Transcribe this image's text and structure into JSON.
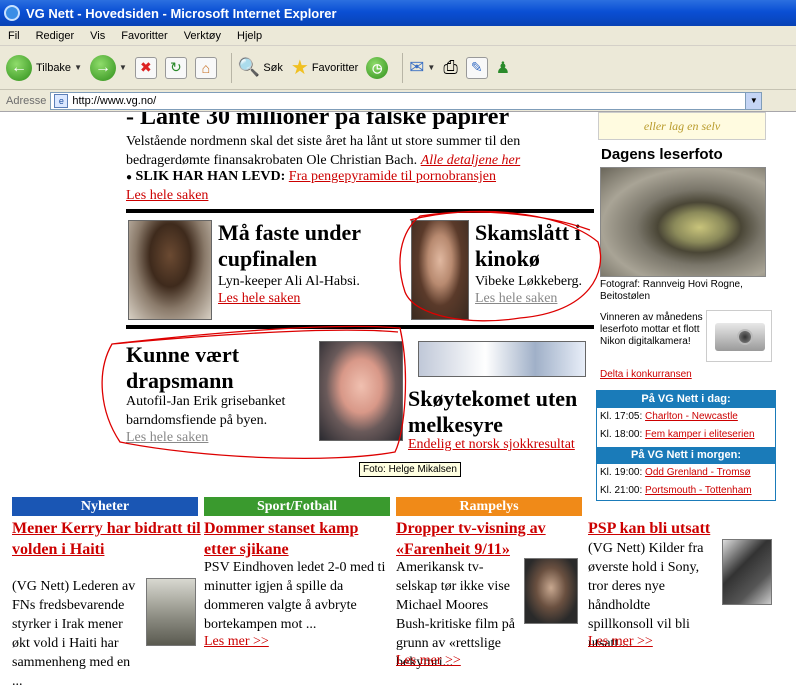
{
  "window": {
    "title": "VG Nett - Hovedsiden - Microsoft Internet Explorer"
  },
  "menu": [
    "Fil",
    "Rediger",
    "Vis",
    "Favoritter",
    "Verktøy",
    "Hjelp"
  ],
  "toolbar": {
    "back": "Tilbake",
    "search": "Søk",
    "favorites": "Favoritter"
  },
  "address": {
    "label": "Adresse",
    "url": "http://www.vg.no/"
  },
  "top_story": {
    "headline": "- Lånte 30 millioner på falske papirer",
    "lead": "Velstående nordmenn skal det siste året ha lånt ut store summer til den bedragerdømte finansakrobaten Ole Christian Bach.",
    "lead_link": "Alle detaljene her",
    "bullet_label": "SLIK HAR HAN LEVD:",
    "bullet_link": "Fra pengepyramide til pornobransjen",
    "more": "Les hele saken"
  },
  "story_cup": {
    "headline": "Må faste under cupfinalen",
    "sub": "Lyn-keeper Ali Al-Habsi.",
    "more": "Les hele saken"
  },
  "story_kino": {
    "headline": "Skamslått i kinokø",
    "sub": "Vibeke Løkkeberg.",
    "more": "Les hele saken"
  },
  "story_drap": {
    "headline": "Kunne vært drapsmann",
    "sub": "Autofil-Jan Erik grisebanket barndomsfiende på byen.",
    "more": "Les hele saken"
  },
  "story_skoyte": {
    "headline": "Skøytekomet uten melkesyre",
    "more": "Endelig et norsk sjokkresultat"
  },
  "photo_credit": "Foto: Helge Mikalsen",
  "sidebar": {
    "banner": "eller lag en selv",
    "leserfoto_title": "Dagens leserfoto",
    "leserfoto_caption": "Fotograf: Rannveig Hovi Rogne, Beitostølen",
    "contest_text": "Vinneren av månedens leserfoto mottar et flott Nikon digitalkamera!",
    "contest_link": "Delta i konkurransen"
  },
  "vg_today": {
    "title": "På VG Nett i dag:",
    "items": [
      {
        "time": "Kl. 17:05:",
        "link": "Charlton - Newcastle"
      },
      {
        "time": "Kl. 18:00:",
        "link": "Fem kamper i eliteserien"
      }
    ]
  },
  "vg_tomorrow": {
    "title": "På VG Nett i morgen:",
    "items": [
      {
        "time": "Kl. 19:00:",
        "link": "Odd Grenland - Tromsø"
      },
      {
        "time": "Kl. 21:00:",
        "link": "Portsmouth - Tottenham"
      }
    ]
  },
  "columns": [
    {
      "section": "Nyheter",
      "color": "#1a56b4",
      "title": "Mener Kerry har bidratt til volden i Haiti",
      "text": "(VG Nett) Lederen av FNs fredsbevarende styrker i Irak mener økt vold i Haiti har sammenheng med en ..."
    },
    {
      "section": "Sport/Fotball",
      "color": "#3a9a2e",
      "title": "Dommer stanset kamp etter sjikane",
      "text": "PSV Eindhoven ledet 2-0 med ti minutter igjen å spille da dommeren valgte å avbryte bortekampen mot ...",
      "more": "Les mer >>"
    },
    {
      "section": "Rampelys",
      "color": "#f08a18",
      "title": "Dropper tv-visning av «Farenheit 9/11»",
      "text": "Amerikansk tv-selskap tør ikke vise Michael Moores Bush-kritiske film på grunn av «rettslige bekymri...",
      "more": "Les mer >>"
    },
    {
      "section": "",
      "color": "#1a7bb9",
      "title": "PSP kan bli utsatt",
      "text": "(VG Nett) Kilder fra øverste hold i Sony, tror deres nye håndholdte spillkonsoll vil bli utsatt....",
      "more": "Les mer >>"
    }
  ]
}
